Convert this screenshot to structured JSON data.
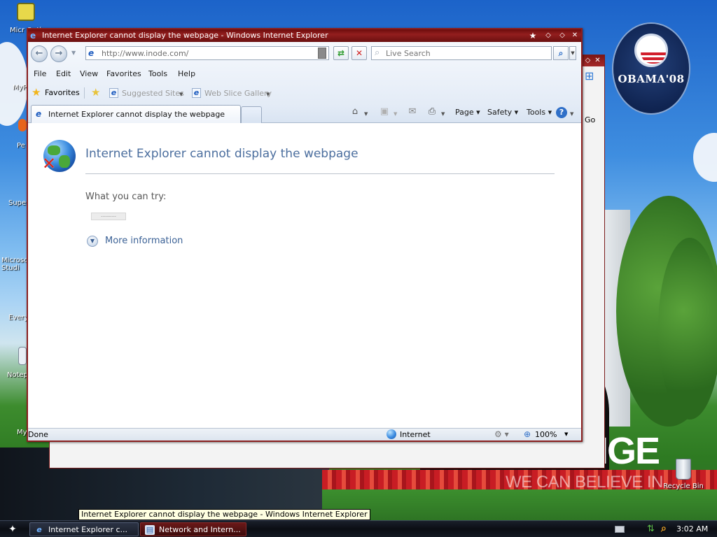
{
  "desktop": {
    "icons": [
      {
        "label": "Micr Outl"
      },
      {
        "label": "MyP"
      },
      {
        "label": "Pe"
      },
      {
        "label": "Supe"
      },
      {
        "label": "Microso Studi"
      },
      {
        "label": "Every"
      },
      {
        "label": "Notep"
      },
      {
        "label": "My"
      }
    ],
    "recycle_bin_label": "Recycle Bin",
    "logo_text": "OBAMA'08",
    "banner_big": "NGE",
    "banner_slogan": "WE CAN BELIEVE IN"
  },
  "background_window": {
    "go_label": "Go"
  },
  "ie": {
    "title": "Internet Explorer cannot display the webpage - Windows Internet Explorer",
    "address": "http://www.inode.com/",
    "search_placeholder": "Live Search",
    "menu": [
      "File",
      "Edit",
      "View",
      "Favorites",
      "Tools",
      "Help"
    ],
    "favorites_label": "Favorites",
    "suggested_sites_label": "Suggested Sites",
    "web_slice_label": "Web Slice Gallery",
    "tab_label": "Internet Explorer cannot display the webpage",
    "commands": {
      "page": "Page",
      "safety": "Safety",
      "tools": "Tools"
    },
    "content": {
      "heading": "Internet Explorer cannot display the webpage",
      "try_label": "What you can try:",
      "diagnose_button": "----------",
      "more_info": "More information"
    },
    "status": {
      "text": "Done",
      "zone": "Internet",
      "zoom": "100%"
    }
  },
  "tooltip": "Internet Explorer cannot display the webpage - Windows Internet Explorer",
  "taskbar": {
    "tasks": [
      {
        "label": "Internet Explorer c..."
      },
      {
        "label": "Network and Intern..."
      }
    ],
    "clock": "3:02 AM"
  },
  "colors": {
    "titlebar": "#931e1e",
    "heading": "#4b6e9e",
    "link": "#3c6296"
  }
}
